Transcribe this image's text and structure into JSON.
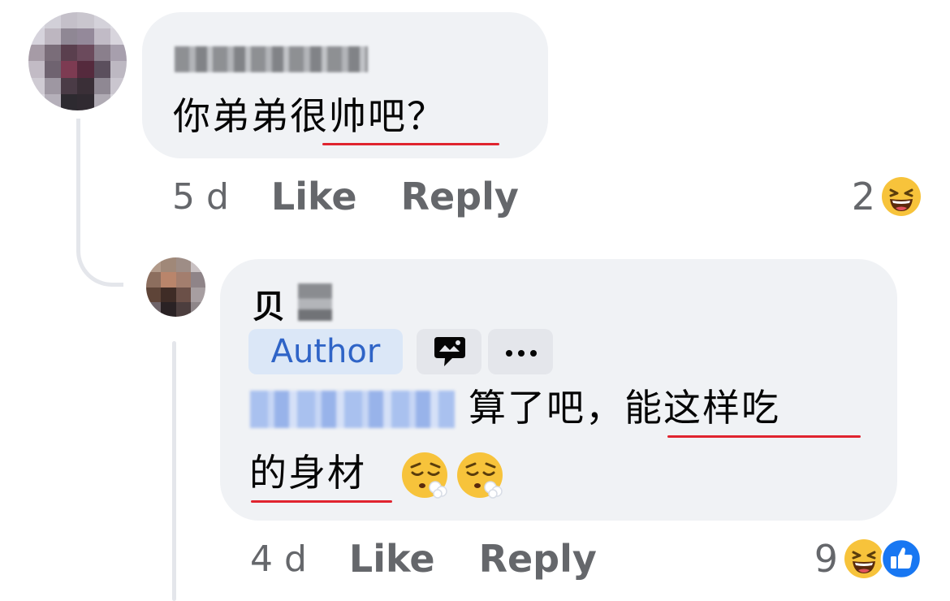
{
  "comment": {
    "author_name": "",
    "text": "你弟弟很帅吧？",
    "timestamp": "5 d",
    "like_label": "Like",
    "reply_label": "Reply",
    "reaction_count": "2",
    "reaction_icons": [
      "laughing-face-icon"
    ]
  },
  "reply": {
    "author_name": "贝",
    "author_badge": "Author",
    "mention": "",
    "text_line_1": "算了吧，能这样吃",
    "text_line_2": "的身材",
    "trailing_emojis": [
      "face-exhaling-icon",
      "face-exhaling-icon"
    ],
    "timestamp": "4 d",
    "like_label": "Like",
    "reply_label": "Reply",
    "reaction_count": "9",
    "reaction_icons": [
      "laughing-face-icon",
      "thumbs-up-icon"
    ]
  },
  "colors": {
    "bubble": "#f0f2f5",
    "secondary_text": "#65676b",
    "author_badge_bg": "#dbe7f7",
    "author_badge_text": "#2f64c7",
    "spellcheck_underline": "#e0242f",
    "like_blue": "#1877f2",
    "emoji_yellow": "#f7c33b"
  }
}
